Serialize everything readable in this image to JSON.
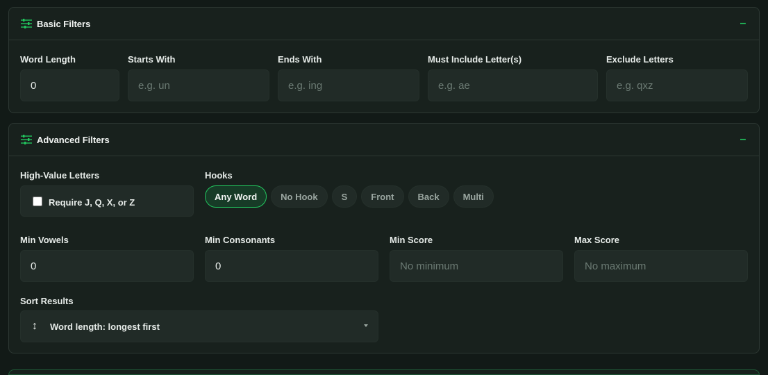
{
  "basic": {
    "title": "Basic Filters",
    "collapse_symbol": "–",
    "word_length": {
      "label": "Word Length",
      "value": "0"
    },
    "starts_with": {
      "label": "Starts With",
      "placeholder": "e.g. un"
    },
    "ends_with": {
      "label": "Ends With",
      "placeholder": "e.g. ing"
    },
    "must_include": {
      "label": "Must Include Letter(s)",
      "placeholder": "e.g. ae"
    },
    "exclude": {
      "label": "Exclude Letters",
      "placeholder": "e.g. qxz"
    }
  },
  "advanced": {
    "title": "Advanced Filters",
    "collapse_symbol": "–",
    "high_value": {
      "label": "High-Value Letters",
      "checkbox_label": "Require J, Q, X, or Z",
      "checked": false
    },
    "hooks": {
      "label": "Hooks",
      "options": [
        "Any Word",
        "No Hook",
        "S",
        "Front",
        "Back",
        "Multi"
      ],
      "active": "Any Word"
    },
    "min_vowels": {
      "label": "Min Vowels",
      "value": "0"
    },
    "min_consonants": {
      "label": "Min Consonants",
      "value": "0"
    },
    "min_score": {
      "label": "Min Score",
      "placeholder": "No minimum"
    },
    "max_score": {
      "label": "Max Score",
      "placeholder": "No maximum"
    },
    "sort": {
      "label": "Sort Results",
      "icon": "↕",
      "selected": "Word length: longest first"
    }
  },
  "colors": {
    "accent": "#22c55e",
    "panel": "#18211d",
    "field": "#212b27",
    "background": "#121a17"
  },
  "icons": {
    "panel_icon": "sliders-icon",
    "sort_icon": "sort-arrows-icon",
    "caret_icon": "caret-down-icon"
  }
}
